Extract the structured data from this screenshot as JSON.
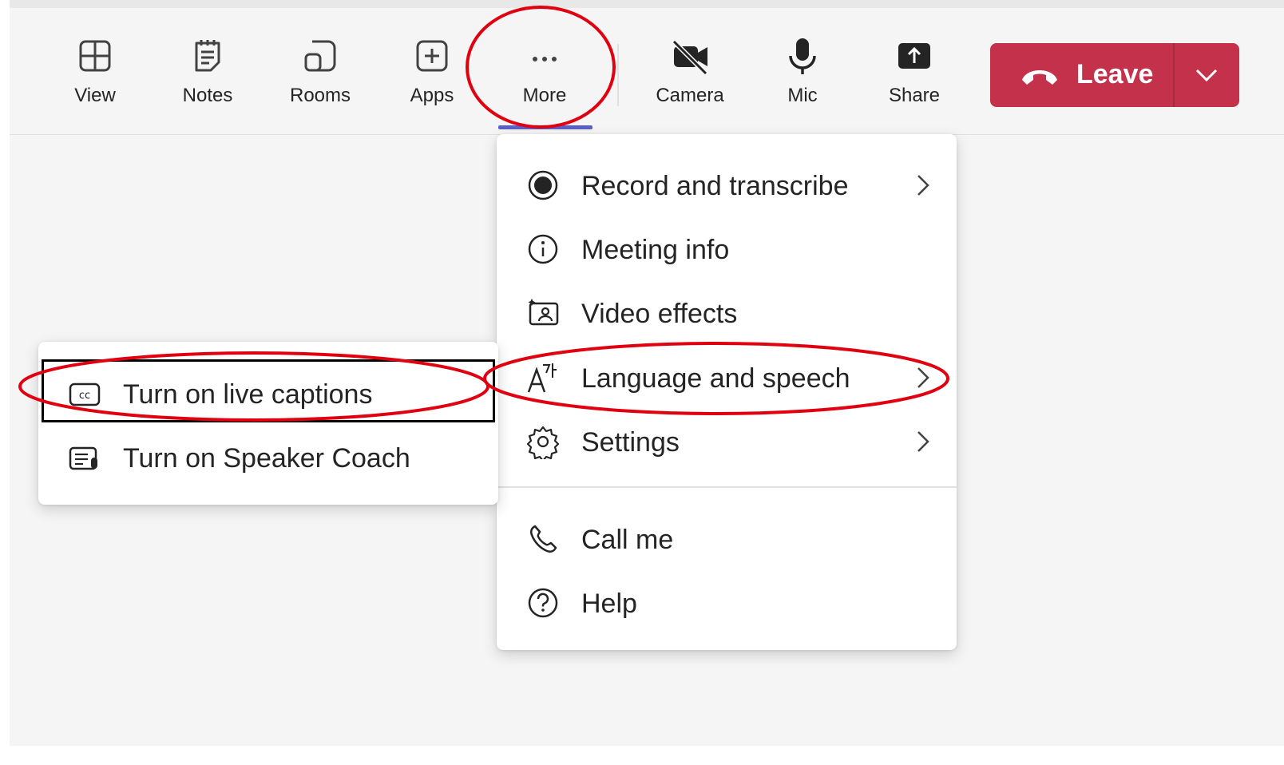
{
  "toolbar": {
    "buttons": [
      {
        "label": "View",
        "icon": "grid-icon"
      },
      {
        "label": "Notes",
        "icon": "notes-icon"
      },
      {
        "label": "Rooms",
        "icon": "rooms-icon"
      },
      {
        "label": "Apps",
        "icon": "apps-plus-icon"
      },
      {
        "label": "More",
        "icon": "more-dots-icon",
        "selected": true
      },
      {
        "label": "Camera",
        "icon": "camera-off-icon"
      },
      {
        "label": "Mic",
        "icon": "mic-icon"
      },
      {
        "label": "Share",
        "icon": "share-tray-icon"
      }
    ],
    "leave": {
      "label": "Leave",
      "color": "#c4314b"
    },
    "accent_color": "#5b5fc7"
  },
  "more_menu": {
    "items": [
      {
        "label": "Record and transcribe",
        "icon": "record-icon",
        "submenu": true
      },
      {
        "label": "Meeting info",
        "icon": "info-icon",
        "submenu": false
      },
      {
        "label": "Video effects",
        "icon": "video-effects-icon",
        "submenu": false
      },
      {
        "label": "Language and speech",
        "icon": "language-icon",
        "submenu": true
      },
      {
        "label": "Settings",
        "icon": "gear-icon",
        "submenu": true
      },
      {
        "label": "Call me",
        "icon": "phone-icon",
        "submenu": false
      },
      {
        "label": "Help",
        "icon": "help-icon",
        "submenu": false
      }
    ]
  },
  "language_submenu": {
    "items": [
      {
        "label": "Turn on live captions",
        "icon": "cc-icon",
        "focused": true
      },
      {
        "label": "Turn on Speaker Coach",
        "icon": "speaker-coach-icon",
        "focused": false
      }
    ]
  },
  "annotation": {
    "highlight_color": "#e0000f"
  }
}
